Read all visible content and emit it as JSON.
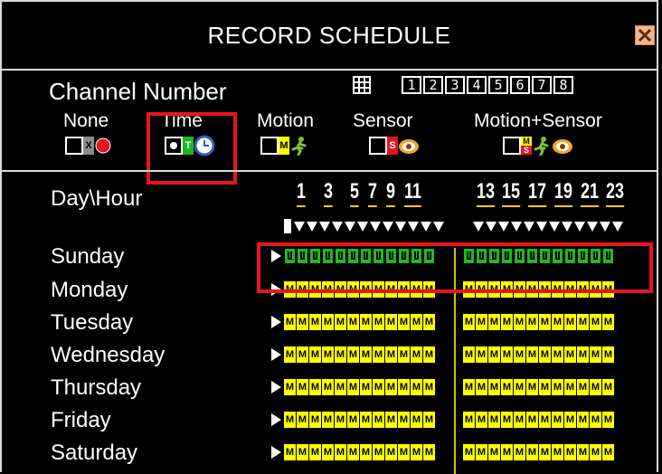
{
  "window": {
    "title": "RECORD SCHEDULE",
    "close_icon": "close-icon",
    "accent_colors": {
      "frame": "#d9d9d9",
      "highlight": "#e8141f",
      "motion": "#ffff00",
      "time": "#1fb81f"
    }
  },
  "channel": {
    "label": "Channel Number",
    "all_icon": "grid-icon",
    "buttons": [
      "1",
      "2",
      "3",
      "4",
      "5",
      "6",
      "7",
      "8"
    ]
  },
  "legend": [
    {
      "label": "None",
      "code": "X",
      "icon": "red-dot-icon"
    },
    {
      "label": "Time",
      "code": "T",
      "icon": "clock-icon"
    },
    {
      "label": "Motion",
      "code": "M",
      "icon": "running-man-icon"
    },
    {
      "label": "Sensor",
      "code": "S",
      "icon": "eye-sensor-icon"
    },
    {
      "label": "Motion+Sensor",
      "code": "MS",
      "icon": "running-man-eye-icon"
    }
  ],
  "schedule": {
    "header_label": "Day\\Hour",
    "hour_labels": [
      "1",
      "3",
      "5",
      "7",
      "9",
      "11",
      "13",
      "15",
      "17",
      "19",
      "21",
      "23"
    ],
    "days": [
      {
        "name": "Sunday",
        "mode": "T"
      },
      {
        "name": "Monday",
        "mode": "M"
      },
      {
        "name": "Tuesday",
        "mode": "M"
      },
      {
        "name": "Wednesday",
        "mode": "M"
      },
      {
        "name": "Thursday",
        "mode": "M"
      },
      {
        "name": "Friday",
        "mode": "M"
      },
      {
        "name": "Saturday",
        "mode": "M"
      }
    ]
  }
}
